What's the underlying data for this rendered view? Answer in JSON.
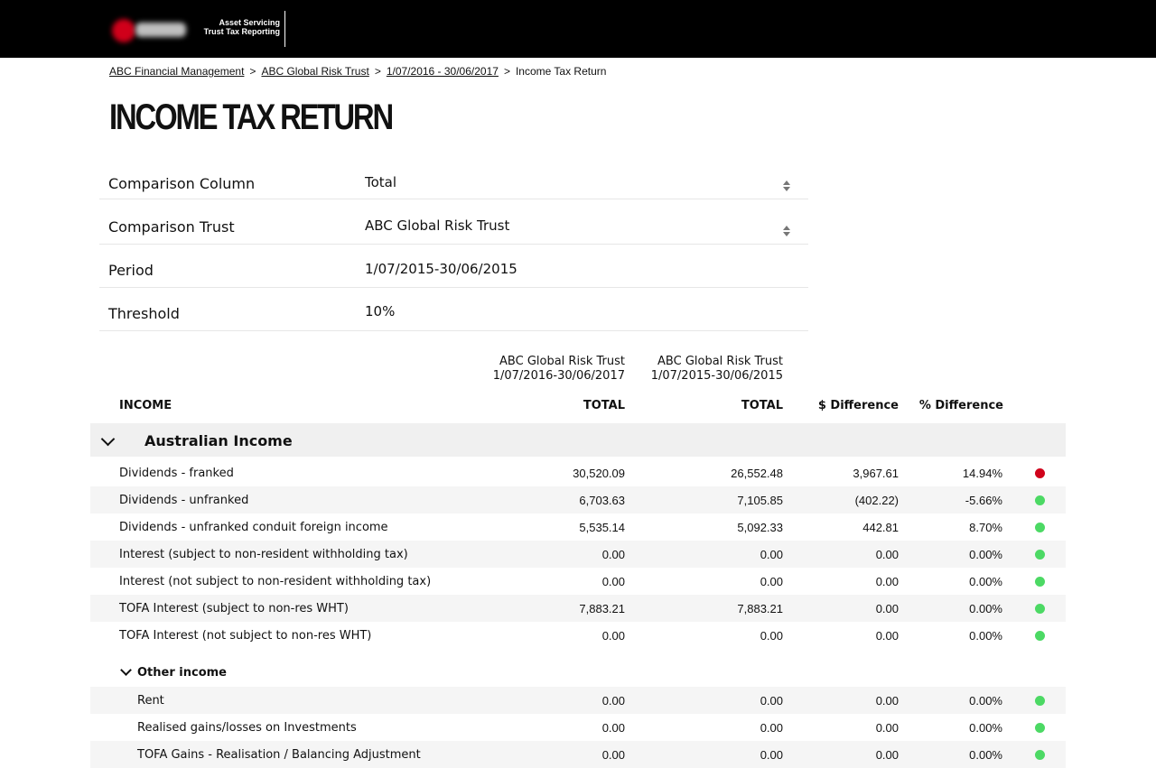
{
  "header": {
    "brand_line1": "Asset Servicing",
    "brand_line2": "Trust Tax Reporting"
  },
  "breadcrumb": [
    "ABC Financial Management",
    "ABC Global Risk Trust",
    "1/07/2016 - 30/06/2017",
    "Income Tax Return"
  ],
  "page_title": "INCOME TAX RETURN",
  "filters": {
    "comparison_column": {
      "label": "Comparison Column",
      "value": "Total"
    },
    "comparison_trust": {
      "label": "Comparison Trust",
      "value": "ABC Global Risk Trust"
    },
    "period": {
      "label": "Period",
      "value": "1/07/2015-30/06/2015"
    },
    "threshold": {
      "label": "Threshold",
      "value": "10%"
    }
  },
  "columns": {
    "current_trust": "ABC Global Risk Trust",
    "current_period": "1/07/2016-30/06/2017",
    "compare_trust": "ABC Global Risk Trust",
    "compare_period": "1/07/2015-30/06/2015",
    "income": "INCOME",
    "total_current": "TOTAL",
    "total_compare": "TOTAL",
    "diff": "$ Difference",
    "pct": "% Difference"
  },
  "colors": {
    "red": "#d0021b",
    "green": "#4cd964"
  },
  "sections": [
    {
      "title": "Australian Income",
      "rows": [
        {
          "label": "Dividends - franked",
          "current": "30,520.09",
          "previous": "26,552.48",
          "diff": "3,967.61",
          "pct": "14.94%",
          "status": "red"
        },
        {
          "label": "Dividends - unfranked",
          "current": "6,703.63",
          "previous": "7,105.85",
          "diff": "(402.22)",
          "pct": "-5.66%",
          "status": "green"
        },
        {
          "label": "Dividends - unfranked conduit foreign income",
          "current": "5,535.14",
          "previous": "5,092.33",
          "diff": "442.81",
          "pct": "8.70%",
          "status": "green"
        },
        {
          "label": "Interest (subject to non-resident withholding tax)",
          "current": "0.00",
          "previous": "0.00",
          "diff": "0.00",
          "pct": "0.00%",
          "status": "green"
        },
        {
          "label": "Interest (not subject to non-resident withholding tax)",
          "current": "0.00",
          "previous": "0.00",
          "diff": "0.00",
          "pct": "0.00%",
          "status": "green"
        },
        {
          "label": "TOFA Interest (subject to non-res WHT)",
          "current": "7,883.21",
          "previous": "7,883.21",
          "diff": "0.00",
          "pct": "0.00%",
          "status": "green"
        },
        {
          "label": "TOFA Interest  (not subject to non-res WHT)",
          "current": "0.00",
          "previous": "0.00",
          "diff": "0.00",
          "pct": "0.00%",
          "status": "green"
        }
      ],
      "subsection": {
        "title": "Other income",
        "rows": [
          {
            "label": "Rent",
            "current": "0.00",
            "previous": "0.00",
            "diff": "0.00",
            "pct": "0.00%",
            "status": "green"
          },
          {
            "label": "Realised gains/losses on Investments",
            "current": "0.00",
            "previous": "0.00",
            "diff": "0.00",
            "pct": "0.00%",
            "status": "green"
          },
          {
            "label": "TOFA Gains - Realisation / Balancing Adjustment",
            "current": "0.00",
            "previous": "0.00",
            "diff": "0.00",
            "pct": "0.00%",
            "status": "green"
          }
        ]
      }
    }
  ]
}
